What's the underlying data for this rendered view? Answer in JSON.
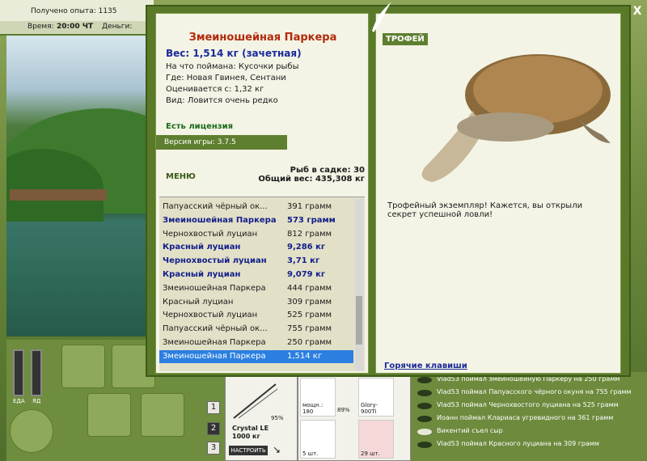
{
  "topbar": {
    "experience": "Получено опыта: 1135",
    "time_label": "Время:",
    "time_value": "20:00 ЧТ",
    "money_label": "Деньги:"
  },
  "dialog": {
    "fish_name": "Змеиношейная Паркера",
    "weight": "Вес: 1,514 кг (зачетная)",
    "caught_on": "На что поймана: Кусочки рыбы",
    "location": "Где: Новая Гвинея, Сентани",
    "value": "Оценивается с: 1,32 кг",
    "rarity": "Вид: Ловится очень редко",
    "license": "Есть лицензия",
    "version": "Версия игры: 3.7.5",
    "menu": "МЕНЮ",
    "fish_in_keepnet": "Рыб в садке: 30",
    "total_weight": "Общий вес: 435,308 кг",
    "trophy_label": "ТРОФЕЙ",
    "trophy_text": "Трофейный экземпляр! Кажется, вы открыли секрет успешной ловли!",
    "hotkeys": "Горячие клавиши",
    "close": "X",
    "fish_list": [
      {
        "name": "Папуасский чёрный ок...",
        "weight": "391 грамм",
        "style": "normal"
      },
      {
        "name": "Змеиношейная Паркера",
        "weight": "573 грамм",
        "style": "bold"
      },
      {
        "name": "Чернохвостый луциан",
        "weight": "812 грамм",
        "style": "normal"
      },
      {
        "name": "Красный луциан",
        "weight": "9,286 кг",
        "style": "bold"
      },
      {
        "name": "Чернохвостый луциан",
        "weight": "3,71 кг",
        "style": "bold"
      },
      {
        "name": "Красный луциан",
        "weight": "9,079 кг",
        "style": "bold"
      },
      {
        "name": "Змеиношейная Паркера",
        "weight": "444 грамм",
        "style": "normal"
      },
      {
        "name": "Красный луциан",
        "weight": "309 грамм",
        "style": "normal"
      },
      {
        "name": "Чернохвостый луциан",
        "weight": "525 грамм",
        "style": "normal"
      },
      {
        "name": "Папуасский чёрный ок...",
        "weight": "755 грамм",
        "style": "normal"
      },
      {
        "name": "Змеиношейная Паркера",
        "weight": "250 грамм",
        "style": "normal"
      },
      {
        "name": "Змеиношейная Паркера",
        "weight": "1,514 кг",
        "style": "selected"
      }
    ]
  },
  "gauges": {
    "food": "ЕДА",
    "poison": "ЯД"
  },
  "slots": {
    "btn1": "1",
    "btn2": "2",
    "btn3": "3"
  },
  "rod": {
    "name": "Crystal LE",
    "weight": "1000 кг",
    "percent": "95%",
    "setup": "НАСТРОИТЬ"
  },
  "items": {
    "reel_label": "мощн.: 180",
    "reel_percent": "89%",
    "line_label": "Glory-900Ti",
    "hook_count": "5 шт.",
    "bait_count": "29 шт."
  },
  "log": [
    "Vlad53 поймал змеиношейную Паркеру на 250 грамм",
    "Vlad53 поймал Папуасского чёрного окуня на 755 грамм",
    "Vlad53 поймал Чернохвостого луциана на 525 грамм",
    "Иоанн поймал Клариаса угревидного на 361 грамм",
    "Викентий съел сыр",
    "Vlad53 поймал Красного луциана на 309 грамм"
  ]
}
